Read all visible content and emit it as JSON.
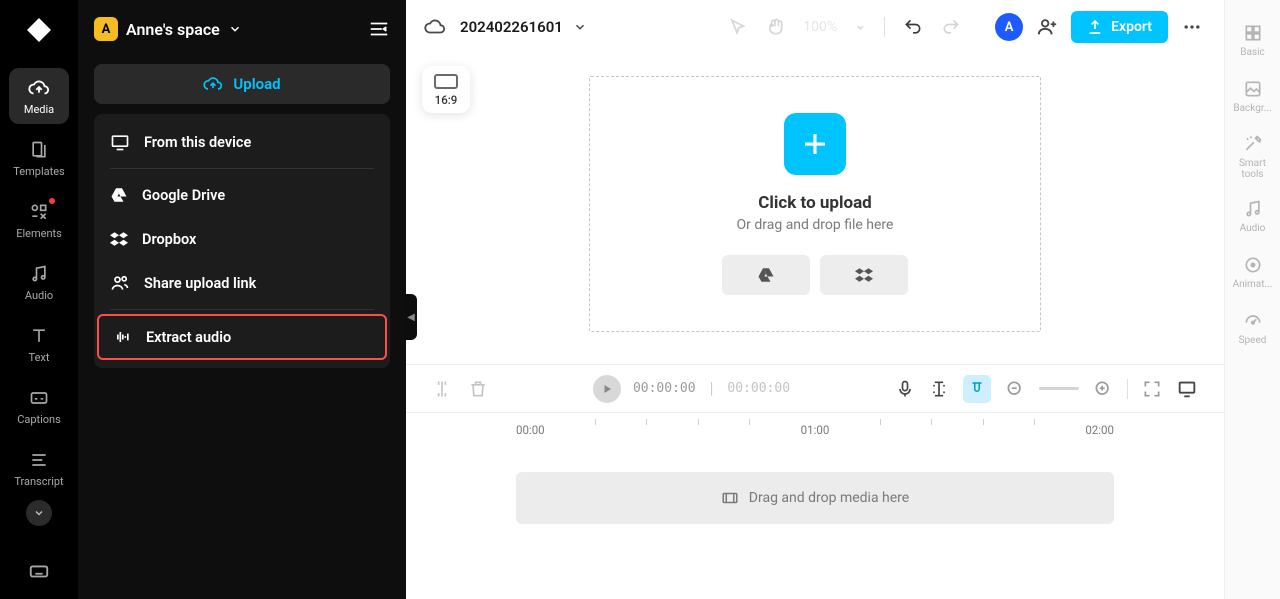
{
  "space": {
    "avatar_letter": "A",
    "name": "Anne's space"
  },
  "left_rail": {
    "items": [
      {
        "label": "Media"
      },
      {
        "label": "Templates"
      },
      {
        "label": "Elements"
      },
      {
        "label": "Audio"
      },
      {
        "label": "Text"
      },
      {
        "label": "Captions"
      },
      {
        "label": "Transcript"
      }
    ]
  },
  "upload": {
    "button_label": "Upload",
    "menu": [
      {
        "label": "From this device"
      },
      {
        "label": "Google Drive"
      },
      {
        "label": "Dropbox"
      },
      {
        "label": "Share upload link"
      },
      {
        "label": "Extract audio"
      }
    ]
  },
  "topbar": {
    "project_name": "202402261601",
    "zoom_pct": "100%",
    "export_label": "Export",
    "user_avatar_letter": "A"
  },
  "canvas": {
    "ratio_label": "16:9",
    "dropzone_title": "Click to upload",
    "dropzone_subtitle": "Or drag and drop file here"
  },
  "timeline": {
    "time_current": "00:00:00",
    "time_total": "00:00:00",
    "ruler_marks": [
      "00:00",
      "01:00",
      "02:00"
    ],
    "track_placeholder": "Drag and drop media here"
  },
  "right_rail": {
    "items": [
      {
        "label": "Basic"
      },
      {
        "label": "Backgr..."
      },
      {
        "label": "Smart tools"
      },
      {
        "label": "Audio"
      },
      {
        "label": "Animat..."
      },
      {
        "label": "Speed"
      }
    ]
  }
}
